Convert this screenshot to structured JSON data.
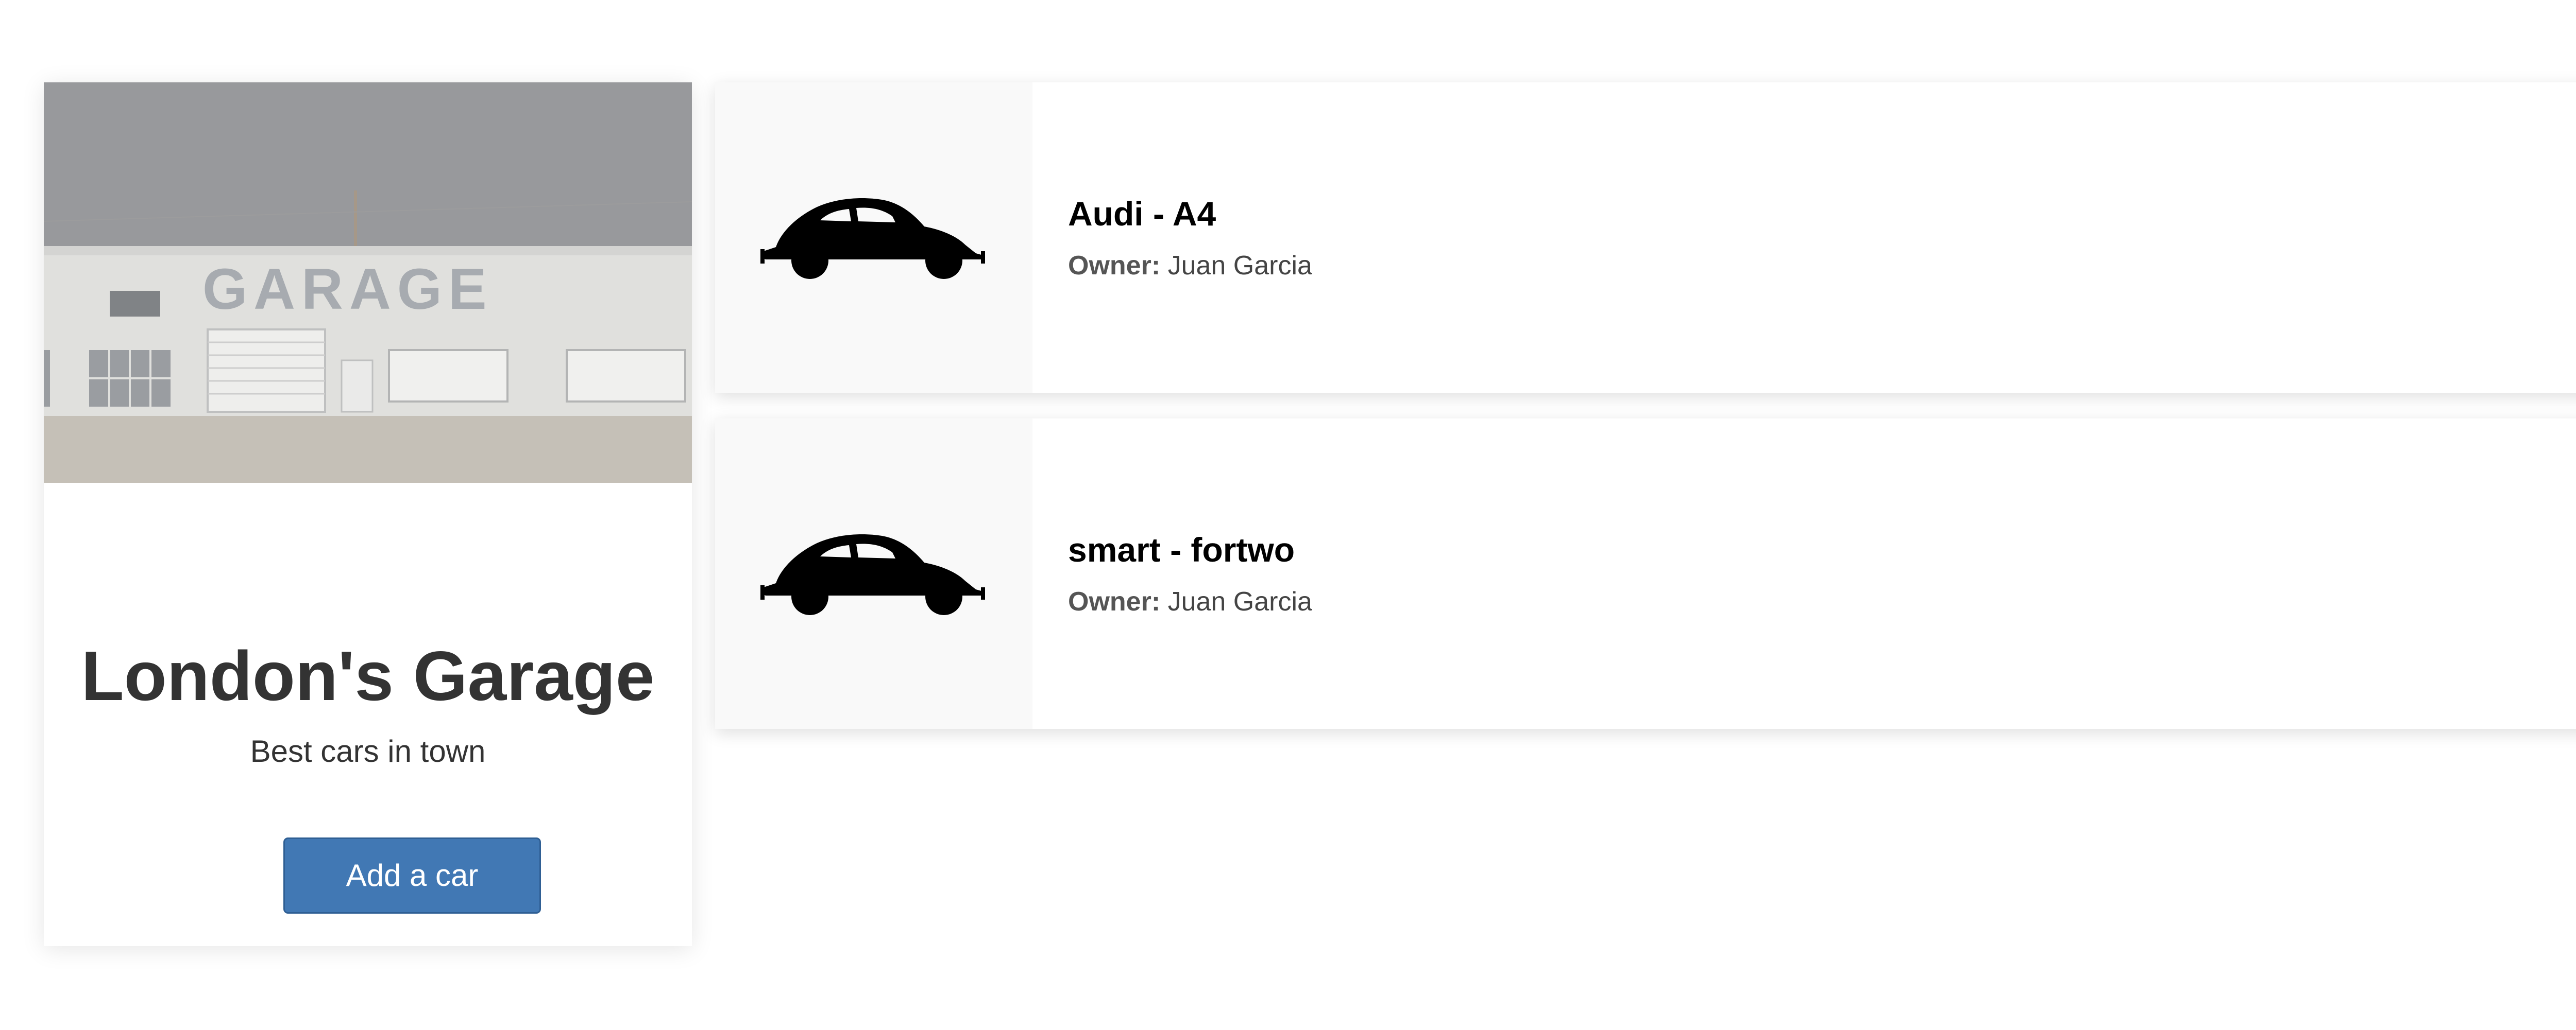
{
  "garage": {
    "title": "London's Garage",
    "subtitle": "Best cars in town",
    "add_button_label": "Add a car",
    "photo_sign_text": "GARAGE"
  },
  "cars": [
    {
      "title": "Audi - A4",
      "owner_label": "Owner:",
      "owner_name": "Juan Garcia",
      "icon": "car-icon"
    },
    {
      "title": "smart - fortwo",
      "owner_label": "Owner:",
      "owner_name": "Juan Garcia",
      "icon": "car-icon"
    }
  ],
  "colors": {
    "button": "#4178b4",
    "title": "#333333",
    "thumb_bg": "#f9f9f9"
  }
}
